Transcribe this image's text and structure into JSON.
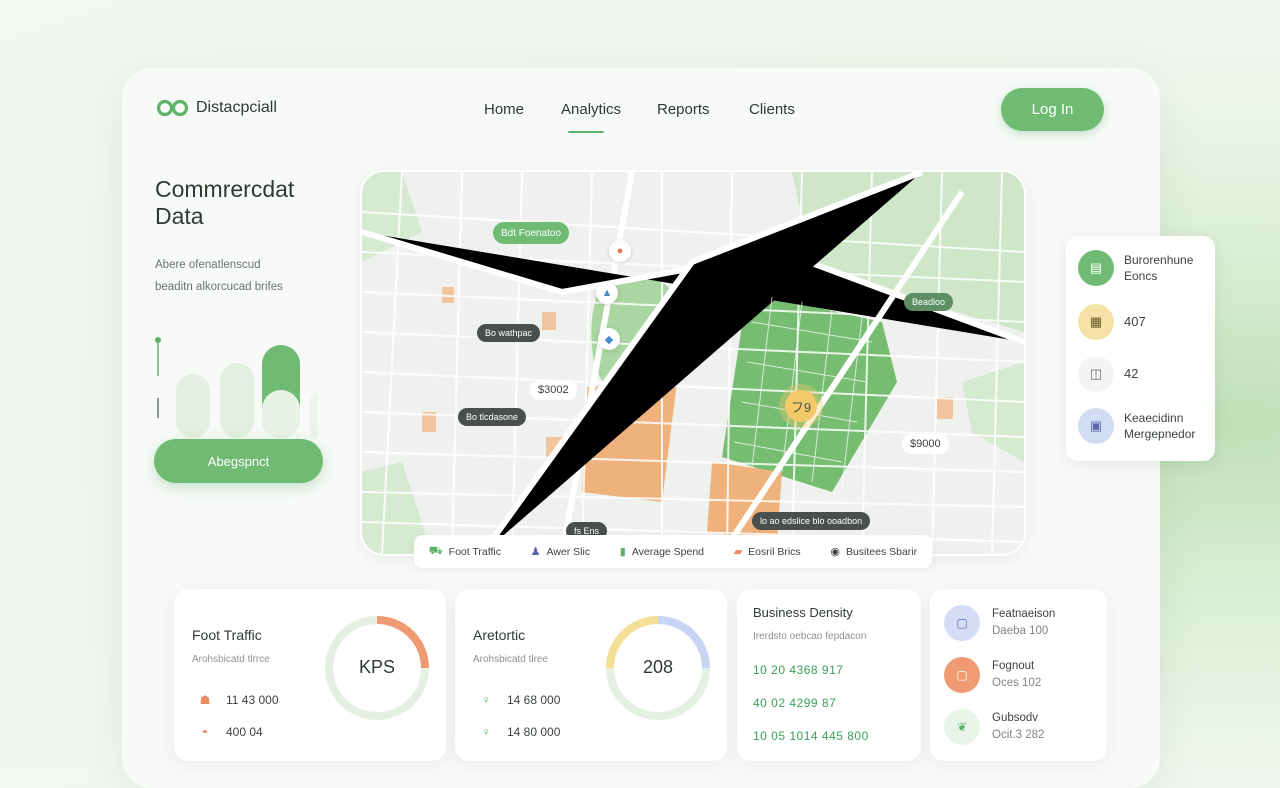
{
  "app": {
    "brand": "Distacpciall",
    "nav": [
      {
        "label": "Home",
        "active": false
      },
      {
        "label": "Analytics",
        "active": true
      },
      {
        "label": "Reports",
        "active": false
      },
      {
        "label": "Clients",
        "active": false
      }
    ],
    "login_label": "Log In",
    "accent_color": "#6fbb73"
  },
  "hero": {
    "title": "Commrercdat Data",
    "subtitle_lines": [
      "Abere ofenatlenscud",
      "beaditn alkorcucad brifes"
    ],
    "button_label": "Abegspnct"
  },
  "map": {
    "labels": {
      "top_tag": "Bdt Foenatoo",
      "dark_tag_1": "Bo wathpac",
      "dark_tag_2": "Bo tlcdasone",
      "price_1": "$3002",
      "right_tag": "Beadloo",
      "price_2": "$9000",
      "bottom_tag_1": "fs  Ens",
      "bottom_tag_2": "lo ao edslice  blo ooadbon",
      "center_pin": "フ9"
    }
  },
  "legend": [
    {
      "icon": "foot-traffic-icon",
      "label": "Foot Traffic"
    },
    {
      "icon": "person-icon",
      "label": "Awer Slic"
    },
    {
      "icon": "spend-icon",
      "label": "Average Spend"
    },
    {
      "icon": "shop-icon",
      "label": "Eosril Brics"
    },
    {
      "icon": "globe-icon",
      "label": "Busitees Sbarir"
    }
  ],
  "side_panel": [
    {
      "icon": "document-icon",
      "line1": "Burorenhune",
      "line2": "Eoncs",
      "color": "#6fbb73"
    },
    {
      "icon": "calendar-icon",
      "line1": "407",
      "line2": "",
      "color": "#f6e2a6"
    },
    {
      "icon": "bag-icon",
      "line1": "42",
      "line2": "",
      "color": "#f3f4f3"
    },
    {
      "icon": "receipt-icon",
      "line1": "Keaecidinn",
      "line2": "Mergepnedor",
      "color": "#d3dcf5"
    }
  ],
  "cards": {
    "foot_traffic": {
      "title": "Foot Traffic",
      "subtitle": "Arohsbicatd tlrrce",
      "ring_label": "KPS",
      "stats": [
        {
          "icon": "people-icon",
          "value": "11 43 000"
        },
        {
          "icon": "bag-icon",
          "value": "400 04"
        }
      ]
    },
    "area": {
      "title": "Aretortic",
      "subtitle": "Arohsbicatd tlree",
      "ring_label": "208",
      "stats": [
        {
          "icon": "pin-icon",
          "value": "14 68 000"
        },
        {
          "icon": "pin-icon",
          "value": "14 80 000"
        }
      ]
    },
    "density": {
      "title": "Business Density",
      "subtitle": "Irerdsto oebcao fepdacon",
      "rows": [
        "10 20  4368 917",
        "40 02  4299 87",
        "10 05  1014 445 800"
      ]
    },
    "feed": [
      {
        "icon": "square-icon",
        "line1": "Featnaeison",
        "line2": "Daeba 100",
        "color": "#d5dcf6"
      },
      {
        "icon": "square-icon",
        "line1": "Fognout",
        "line2": "Oces 102",
        "color": "#ef9a73"
      },
      {
        "icon": "leaf-icon",
        "line1": "Gubsodv",
        "line2": "Ocit.3 282",
        "color": "#e9f4e8"
      }
    ]
  }
}
